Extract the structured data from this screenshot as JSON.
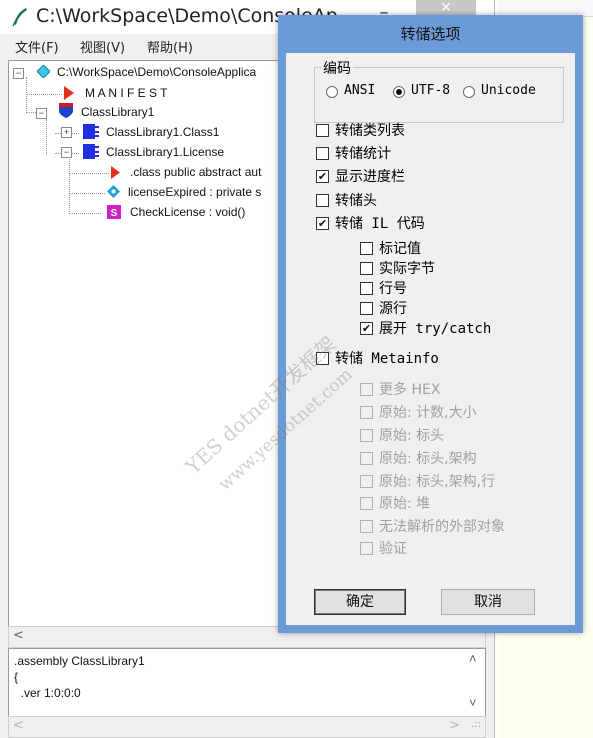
{
  "main_window": {
    "title": "C:\\WorkSpace\\Demo\\ConsoleAp",
    "minimize": "–",
    "close": "✕",
    "menu": [
      "文件(F)",
      "视图(V)",
      "帮助(H)"
    ]
  },
  "tree": {
    "root": "C:\\WorkSpace\\Demo\\ConsoleApplica",
    "manifest": "M A N I F E S T",
    "library": "ClassLibrary1",
    "class1": "ClassLibrary1.Class1",
    "license": "ClassLibrary1.License",
    "class_decl": ".class public abstract aut",
    "field": "licenseExpired : private s",
    "method": "CheckLicense : void()",
    "icons": {
      "root": "diamond-icon",
      "manifest": "red-triangle-icon",
      "library": "blue-shield-icon",
      "class": "blue-class-icon",
      "field": "cyan-diamond-icon",
      "method": "magenta-s-icon"
    },
    "expanders": [
      "−",
      "−",
      "+",
      "−"
    ]
  },
  "code_pane": {
    "lines": [
      ".assembly ClassLibrary1",
      "{",
      "  .ver 1:0:0:0"
    ]
  },
  "dialog": {
    "title": "转储选项",
    "encoding": {
      "label": "编码",
      "options": [
        "ANSI",
        "UTF-8",
        "Unicode"
      ],
      "selected": "UTF-8"
    },
    "options": [
      {
        "label": "转储类列表",
        "checked": false,
        "enabled": true
      },
      {
        "label": "转储统计",
        "checked": false,
        "enabled": true
      },
      {
        "label": "显示进度栏",
        "checked": true,
        "enabled": true
      },
      {
        "label": "转储头",
        "checked": false,
        "enabled": true
      },
      {
        "label": "转储 IL 代码",
        "checked": true,
        "enabled": true
      }
    ],
    "il_suboptions": [
      {
        "label": "标记值",
        "checked": false
      },
      {
        "label": "实际字节",
        "checked": false
      },
      {
        "label": "行号",
        "checked": false
      },
      {
        "label": "源行",
        "checked": false
      },
      {
        "label": "展开 try/catch",
        "checked": true
      }
    ],
    "metainfo": {
      "label": "转储 Metainfo",
      "checked": false
    },
    "metainfo_suboptions": [
      "更多 HEX",
      "原始: 计数,大小",
      "原始: 标头",
      "原始: 标头,架构",
      "原始: 标头,架构,行",
      "原始: 堆",
      "无法解析的外部对象",
      "验证"
    ],
    "ok_label": "确定",
    "cancel_label": "取消"
  },
  "watermark": {
    "line1": "YES dotnet开发框架",
    "line2": "www.yesdotnet.com"
  },
  "colors": {
    "dialog_frame": "#6b9bd6",
    "window_bg": "#f0f0f0",
    "right_pane": "#fffff0"
  }
}
